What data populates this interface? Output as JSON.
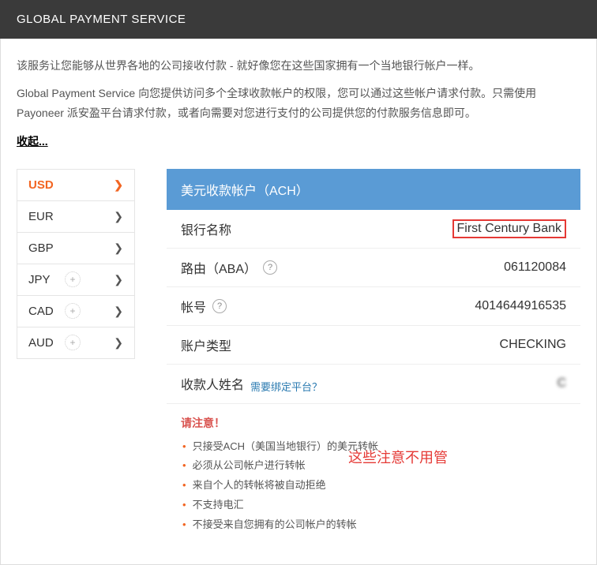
{
  "header": {
    "title": "GLOBAL PAYMENT SERVICE"
  },
  "intro": {
    "p1": "该服务让您能够从世界各地的公司接收付款 - 就好像您在这些国家拥有一个当地银行帐户一样。",
    "p2": "Global Payment Service 向您提供访问多个全球收款帐户的权限，您可以通过这些帐户请求付款。只需使用 Payoneer 派安盈平台请求付款，或者向需要对您进行支付的公司提供您的付款服务信息即可。",
    "collapse": "收起..."
  },
  "sidebar": {
    "tabs": [
      {
        "code": "USD",
        "has_add": false,
        "active": true
      },
      {
        "code": "EUR",
        "has_add": false,
        "active": false
      },
      {
        "code": "GBP",
        "has_add": false,
        "active": false
      },
      {
        "code": "JPY",
        "has_add": true,
        "active": false
      },
      {
        "code": "CAD",
        "has_add": true,
        "active": false
      },
      {
        "code": "AUD",
        "has_add": true,
        "active": false
      }
    ]
  },
  "card": {
    "title": "美元收款帐户（ACH）",
    "rows": {
      "bank_name": {
        "label": "银行名称",
        "value": "First Century Bank"
      },
      "routing": {
        "label": "路由（ABA）",
        "value": "061120084"
      },
      "account_no": {
        "label": "帐号",
        "value": "4014644916535"
      },
      "acct_type": {
        "label": "账户类型",
        "value": "CHECKING"
      },
      "beneficiary": {
        "label": "收款人姓名",
        "value": "C",
        "blurred": true
      }
    },
    "bind_link": "需要绑定平台？"
  },
  "notice": {
    "title": "请注意！",
    "items": [
      "只接受ACH（美国当地银行）的美元转帐",
      "必须从公司帐户进行转帐",
      "来自个人的转帐将被自动拒绝",
      "不支持电汇",
      "不接受来自您拥有的公司帐户的转帐"
    ],
    "overlay": "这些注意不用管"
  }
}
